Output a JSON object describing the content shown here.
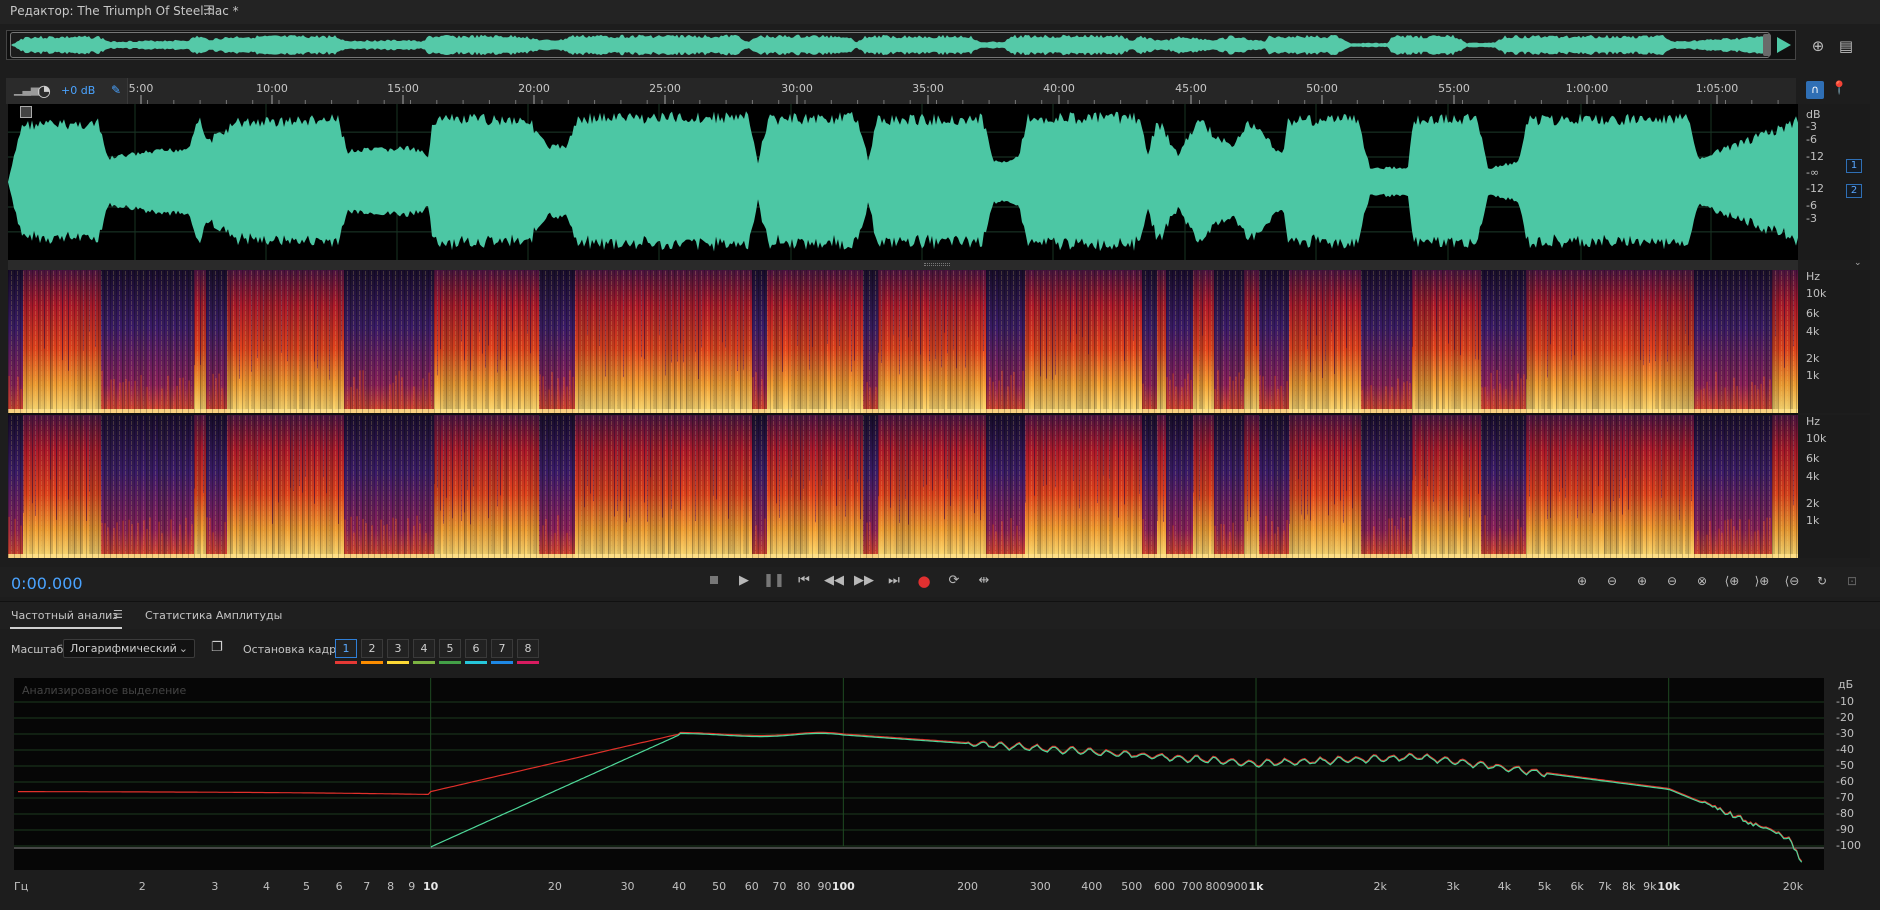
{
  "title": {
    "text": "Редактор: The Triumph Of Steel.flac *"
  },
  "ruler": {
    "gain": "+0 dB",
    "ticks": [
      "5:00",
      "10:00",
      "15:00",
      "20:00",
      "25:00",
      "30:00",
      "35:00",
      "40:00",
      "45:00",
      "50:00",
      "55:00",
      "1:00:00",
      "1:05:00"
    ]
  },
  "amp_scale": {
    "labels": [
      "dB",
      "-3",
      "-6",
      "-12",
      "-∞",
      "-12",
      "-6",
      "-3"
    ]
  },
  "channels": [
    "1",
    "2"
  ],
  "freq_scale": {
    "labels": [
      "Hz",
      "10k",
      "6k",
      "4k",
      "2k",
      "1k"
    ]
  },
  "transport": {
    "timecode": "0:00.000"
  },
  "panel": {
    "tabs": [
      "Частотный анализ",
      "Статистика Амплитуды"
    ],
    "scale_label": "Масштаб:",
    "scale_value": "Логарифмический",
    "freeze_label": "Остановка кадра:",
    "frames": [
      "1",
      "2",
      "3",
      "4",
      "5",
      "6",
      "7",
      "8"
    ],
    "frame_colors": [
      "#e53935",
      "#fb8c00",
      "#fdd835",
      "#7cb342",
      "#43a047",
      "#26c6da",
      "#1e88e5",
      "#d81b60"
    ],
    "analyzed_label": "Анализированое выделение"
  },
  "spectrum_axis": {
    "db_unit": "дБ",
    "db_labels": [
      "-10",
      "-20",
      "-30",
      "-40",
      "-50",
      "-60",
      "-70",
      "-80",
      "-90",
      "-100"
    ],
    "hz_unit": "Гц",
    "hz_labels": [
      "2",
      "3",
      "4",
      "5",
      "6",
      "7",
      "8",
      "9",
      "10",
      "20",
      "30",
      "40",
      "50",
      "60",
      "70",
      "80",
      "90",
      "100",
      "200",
      "300",
      "400",
      "500",
      "600",
      "700",
      "800",
      "900",
      "1k",
      "2k",
      "3k",
      "4k",
      "5k",
      "6k",
      "7k",
      "8k",
      "9k",
      "10k",
      "20k"
    ]
  },
  "colors": {
    "accent": "#4aa3ff",
    "waveform": "#4cc7a4",
    "red_trace": "#e0302a",
    "green_trace": "#4fd89a"
  }
}
